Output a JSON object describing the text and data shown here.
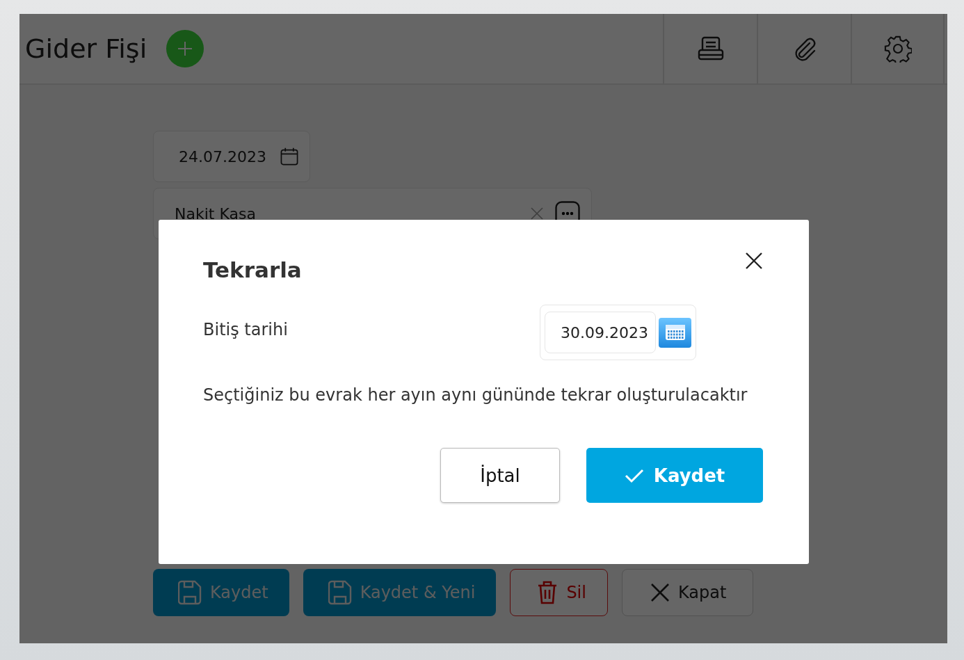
{
  "header": {
    "title": "Gider Fişi"
  },
  "form": {
    "date": "24.07.2023",
    "account": "Nakit Kasa"
  },
  "actions": [
    {
      "kind": "save",
      "label": "Kaydet"
    },
    {
      "kind": "save",
      "label": "Kaydet & Yeni"
    },
    {
      "kind": "delete",
      "label": "Sil"
    },
    {
      "kind": "close",
      "label": "Kapat"
    }
  ],
  "dialog": {
    "title": "Tekrarla",
    "end_date_label": "Bitiş tarihi",
    "end_date": "30.09.2023",
    "message": "Seçtiğiniz bu evrak her ayın aynı gününde tekrar oluşturulacaktır",
    "buttons": [
      {
        "kind": "cancel",
        "label": "İptal"
      },
      {
        "kind": "confirm",
        "label": "Kaydet"
      }
    ]
  }
}
